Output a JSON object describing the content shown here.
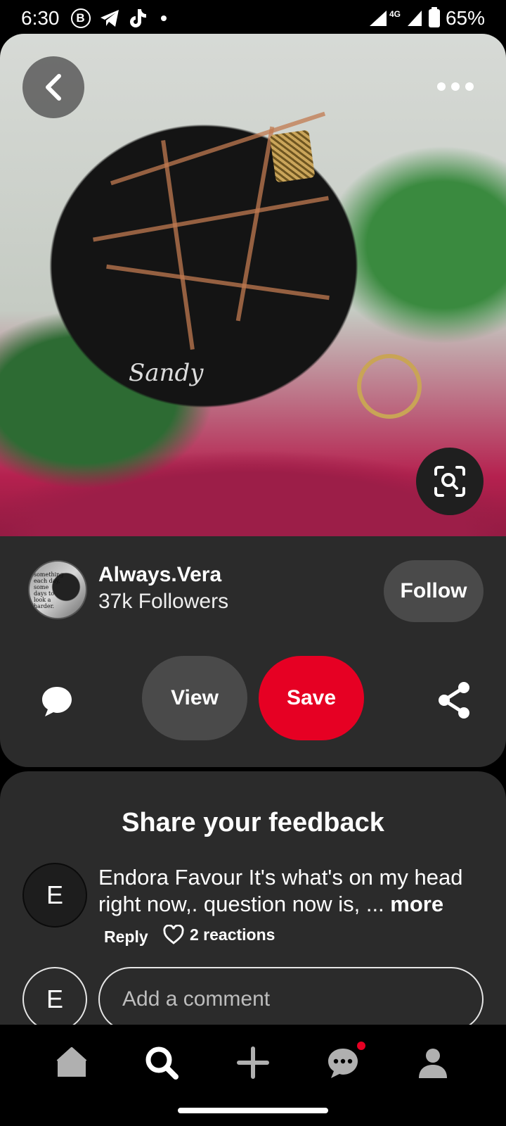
{
  "status_bar": {
    "time": "6:30",
    "b_icon": "B",
    "signal_label": "4G",
    "battery": "65%"
  },
  "pin": {
    "watermark": "Sandy",
    "back_icon": "chevron-left-icon",
    "more_icon": "more-dots-icon",
    "lens_icon": "visual-search-icon"
  },
  "creator": {
    "name": "Always.Vera",
    "followers": "37k Followers",
    "avatar_text": "something each day, some days to look a harder.",
    "follow_label": "Follow"
  },
  "actions": {
    "view_label": "View",
    "save_label": "Save",
    "save_color": "#e60023"
  },
  "feedback": {
    "title": "Share your feedback",
    "comment": {
      "avatar_letter": "E",
      "text": "Endora Favour It's what's on my head right now,. question now is, ...",
      "more_label": "more",
      "reply_label": "Reply",
      "reactions_label": "2 reactions"
    },
    "input": {
      "avatar_letter": "E",
      "placeholder": "Add a comment"
    }
  },
  "nav": {
    "items": [
      "home-icon",
      "search-icon",
      "create-icon",
      "messages-icon",
      "profile-icon"
    ]
  }
}
